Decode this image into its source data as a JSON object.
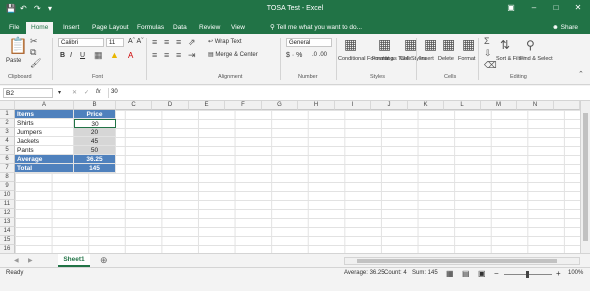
{
  "title": "TOSA Test - Excel",
  "tabs": [
    "File",
    "Home",
    "Insert",
    "Page Layout",
    "Formulas",
    "Data",
    "Review",
    "View"
  ],
  "tell_me": "Tell me what you want to do...",
  "share": "Share",
  "ribbon": {
    "paste": "Paste",
    "font_name": "Calibri",
    "font_size": "11",
    "wrap_text": "Wrap Text",
    "merge_center": "Merge & Center",
    "number_format": "General",
    "conditional": "Conditional Formatting",
    "format_as": "Format as Table",
    "cell_styles": "Cell Styles",
    "insert": "Insert",
    "delete": "Delete",
    "format": "Format",
    "sort_filter": "Sort & Filter",
    "find_select": "Find & Select",
    "groups": [
      "Clipboard",
      "Font",
      "Alignment",
      "Number",
      "Styles",
      "Cells",
      "Editing"
    ]
  },
  "formula_bar": {
    "name_box": "B2",
    "fx": "fx",
    "value": "30"
  },
  "columns": [
    "A",
    "B",
    "C",
    "D",
    "E",
    "F",
    "G",
    "H",
    "I",
    "J",
    "K",
    "L",
    "M",
    "N"
  ],
  "rows": [
    "1",
    "2",
    "3",
    "4",
    "5",
    "6",
    "7",
    "8",
    "9",
    "10",
    "11",
    "12",
    "13",
    "14",
    "15",
    "16"
  ],
  "table": {
    "header": [
      "Items",
      "Price"
    ],
    "items": [
      {
        "name": "Shirts",
        "price": "30"
      },
      {
        "name": "Jumpers",
        "price": "20"
      },
      {
        "name": "Jackets",
        "price": "45"
      },
      {
        "name": "Pants",
        "price": "50"
      }
    ],
    "average_label": "Average",
    "average_value": "36.25",
    "total_label": "Total",
    "total_value": "145"
  },
  "sheet_tab": "Sheet1",
  "status": {
    "ready": "Ready",
    "average": "Average: 36.25",
    "count": "Count: 4",
    "sum": "Sum: 145",
    "zoom": "100%"
  },
  "colors": {
    "excel_green": "#217346",
    "table_header": "#4f81bd"
  }
}
